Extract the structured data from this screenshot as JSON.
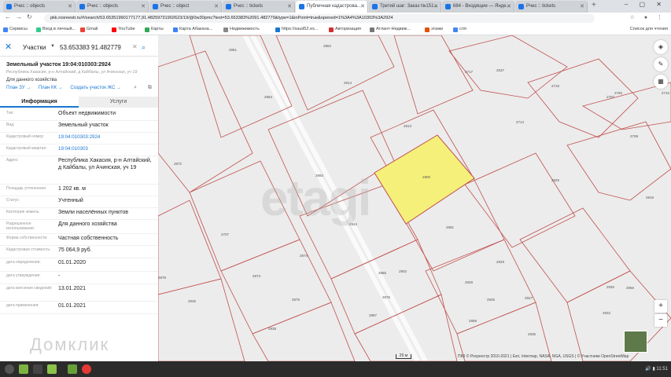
{
  "browser": {
    "tabs": [
      {
        "title": "Рчес :: objects",
        "active": false
      },
      {
        "title": "Рчес :: objects",
        "active": false
      },
      {
        "title": "Рчес :: object",
        "active": false
      },
      {
        "title": "Рчес :: tickets",
        "active": false
      },
      {
        "title": "Публичная кадастрова...",
        "active": true
      },
      {
        "title": "Третий шаг: Заказ №151...",
        "active": false
      },
      {
        "title": "684 - Входящие — Янде...",
        "active": false
      },
      {
        "title": "Рчес :: tickets",
        "active": false
      }
    ],
    "url": "pkk.rosreestr.ru/#/search/53.65351990177177,91.48259731902623/19/@0w30pmc?text=53.653383%2091.482779&type=1&inPoint=true&opened=1%3A4%3A10303%3A2924",
    "bookmarks": [
      "Сервисы",
      "Вход в личный...",
      "Gmail",
      "YouTube",
      "Карты",
      "Карта Абакана...",
      "Недвижимость",
      "https://saud52.es...",
      "Авторизация",
      "Атлант-Недвиж...",
      "этажи",
      "crm"
    ],
    "reading_list": "Список для чтения"
  },
  "search": {
    "type": "Участки",
    "query": "53.653383 91.482779"
  },
  "object": {
    "title": "Земельный участок 19:04:010303:2924",
    "address_short": "Республика Хакасия, р-н Алтайский, д Кайбалы, ул Ачинская, уч 19",
    "purpose": "Для данного хозяйства",
    "links": [
      "План ЗУ →",
      "План КК →",
      "Создать участок ЖС →"
    ]
  },
  "tabs": {
    "info": "Информация",
    "services": "Услуги"
  },
  "rows": [
    {
      "label": "Тип:",
      "value": "Объект недвижимости",
      "link": false
    },
    {
      "label": "Вид:",
      "value": "Земельный участок",
      "link": false
    },
    {
      "label": "Кадастровый номер:",
      "value": "19:04:010303:2924",
      "link": true
    },
    {
      "label": "Кадастровый квартал:",
      "value": "19:04:010303",
      "link": true
    },
    {
      "label": "Адрес:",
      "value": "Республика Хакасия, р-н Алтайский, д Кайбалы, ул Ачинская, уч 19",
      "link": false
    },
    {
      "label": "Площадь уточненная:",
      "value": "1 202 кв. м",
      "link": false
    },
    {
      "label": "Статус:",
      "value": "Учтенный",
      "link": false
    },
    {
      "label": "Категория земель:",
      "value": "Земли населённых пунктов",
      "link": false
    },
    {
      "label": "Разрешенное использование:",
      "value": "Для данного хозяйства",
      "link": false
    },
    {
      "label": "Форма собственности:",
      "value": "Частная собственность",
      "link": false
    },
    {
      "label": "Кадастровая стоимость:",
      "value": "75 064,9 руб.",
      "link": false
    },
    {
      "label": "дата определения:",
      "value": "01.01.2020",
      "link": false
    },
    {
      "label": "дата утверждения:",
      "value": "-",
      "link": false
    },
    {
      "label": "дата внесения сведений:",
      "value": "13.01.2021",
      "link": false
    },
    {
      "label": "дата применения:",
      "value": "01.01.2021",
      "link": false
    }
  ],
  "map": {
    "watermark": "etagi",
    "domclick": "Домклик",
    "scale": "20 м",
    "attribution": "ПКК © Росреестр 2010-2021 | Esri, Intermap, NASA, NGA, USGS | © Участники OpenStreetMap",
    "highlight_color": "#f5f07a",
    "parcel_line_color": "#c0504d",
    "parcel_labels": [
      "2861",
      "2862",
      "2913",
      "2717",
      "2637",
      "2714",
      "2715",
      "2707",
      "2708",
      "2863",
      "2914",
      "2765",
      "2710",
      "2872",
      "2892",
      "2900",
      "2924",
      "2891",
      "2925",
      "2707",
      "2873",
      "2874",
      "2902",
      "2928",
      "2929",
      "2879",
      "2875",
      "2886",
      "2926",
      "2930",
      "2936",
      "2887",
      "2919",
      "2927",
      "2966",
      "2938",
      "2876",
      "2888",
      "2935",
      "2932"
    ]
  },
  "taskbar": {
    "clock": "11:51"
  }
}
